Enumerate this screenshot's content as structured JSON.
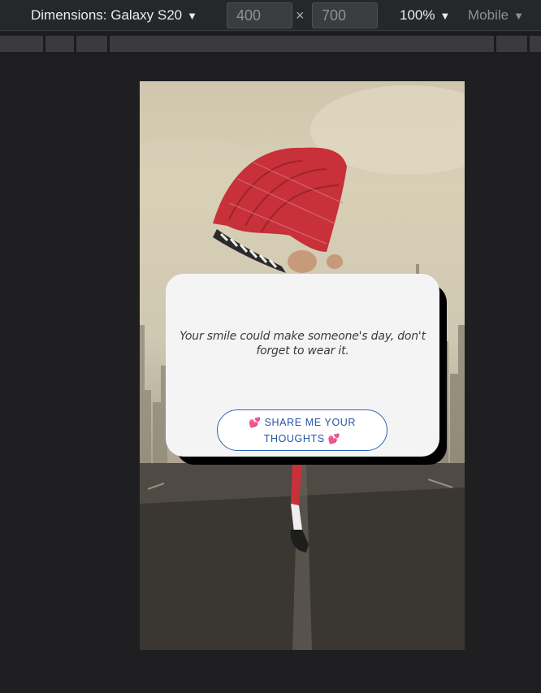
{
  "devtools": {
    "dimensions_label": "Dimensions: Galaxy S20",
    "width_value": "400",
    "height_value": "700",
    "times_symbol": "×",
    "zoom_label": "100%",
    "mode_label": "Mobile",
    "caret": "▼"
  },
  "card": {
    "quote": "Your smile could make someone's day, don't forget to wear it.",
    "button_line1": "SHARE ME YOUR",
    "button_line2": "THOUGHTS",
    "heart_emoji": "💕"
  },
  "colors": {
    "devtools_bg": "#262729",
    "page_bg": "#1f1f21",
    "card_bg": "#f4f4f5",
    "button_border": "#2f63b8",
    "button_text": "#2554a6",
    "scarf_red": "#c8303a"
  }
}
